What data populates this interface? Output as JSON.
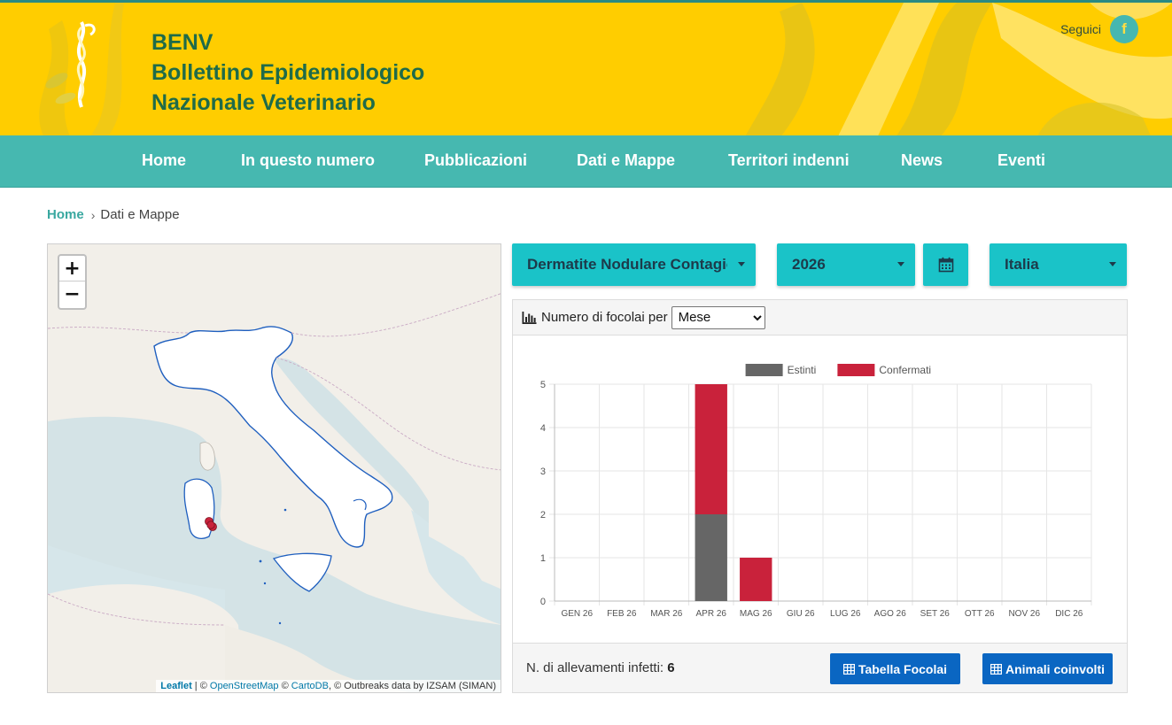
{
  "header": {
    "title_line1": "BENV",
    "title_line2": "Bollettino Epidemiologico",
    "title_line3": "Nazionale Veterinario",
    "follow_label": "Seguici",
    "facebook_glyph": "f"
  },
  "nav": {
    "items": [
      {
        "label": "Home"
      },
      {
        "label": "In questo numero"
      },
      {
        "label": "Pubblicazioni"
      },
      {
        "label": "Dati e Mappe"
      },
      {
        "label": "Territori indenni"
      },
      {
        "label": "News"
      },
      {
        "label": "Eventi"
      }
    ]
  },
  "breadcrumb": {
    "home": "Home",
    "separator": "›",
    "current": "Dati e Mappe"
  },
  "map": {
    "zoom_in": "+",
    "zoom_out": "−",
    "attribution": {
      "leaflet": "Leaflet",
      "sep1": " | © ",
      "osm": "OpenStreetMap",
      "sep2": " © ",
      "carto": "CartoDB",
      "rest": ", © Outbreaks data by IZSAM (SIMAN)"
    }
  },
  "filters": {
    "disease": "Dermatite Nodulare Contagiosa",
    "year": "2026",
    "calendar_icon": "calendar-icon",
    "area": "Italia"
  },
  "chart_panel": {
    "heading": "Numero di focolai per",
    "period_select": "Mese",
    "period_options": [
      "Mese"
    ]
  },
  "chart_data": {
    "type": "bar",
    "stacked": true,
    "categories": [
      "GEN 26",
      "FEB 26",
      "MAR 26",
      "APR 26",
      "MAG 26",
      "GIU 26",
      "LUG 26",
      "AGO 26",
      "SET 26",
      "OTT 26",
      "NOV 26",
      "DIC 26"
    ],
    "series": [
      {
        "name": "Estinti",
        "color": "#666666",
        "values": [
          0,
          0,
          0,
          2,
          0,
          0,
          0,
          0,
          0,
          0,
          0,
          0
        ]
      },
      {
        "name": "Confermati",
        "color": "#c9223b",
        "values": [
          0,
          0,
          0,
          3,
          1,
          0,
          0,
          0,
          0,
          0,
          0,
          0
        ]
      }
    ],
    "ylim": [
      0,
      5
    ],
    "yticks": [
      0,
      1,
      2,
      3,
      4,
      5
    ],
    "grid": true,
    "legend": "top"
  },
  "footer": {
    "infected_label": "N. di allevamenti infetti:",
    "infected_value": "6",
    "table_button": "Tabella Focolai",
    "animals_button": "Animali coinvolti"
  },
  "colors": {
    "header_yellow": "#ffcd00",
    "nav_teal": "#46b8b0",
    "filter_cyan": "#1ac3c8",
    "button_blue": "#0a66c2"
  }
}
